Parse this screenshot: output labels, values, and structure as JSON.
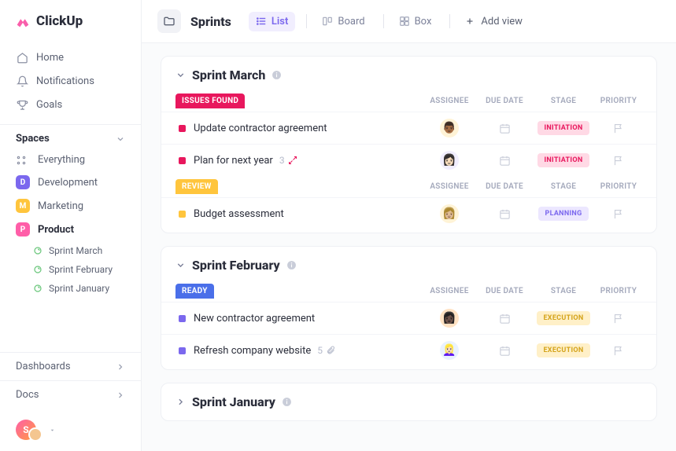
{
  "brand": "ClickUp",
  "nav": {
    "home": "Home",
    "notifications": "Notifications",
    "goals": "Goals"
  },
  "spaces_label": "Spaces",
  "everything": "Everything",
  "spaces": [
    {
      "initial": "D",
      "label": "Development",
      "color": "#7b68ee"
    },
    {
      "initial": "M",
      "label": "Marketing",
      "color": "#ffc53d"
    },
    {
      "initial": "P",
      "label": "Product",
      "color": "#ff5ea8",
      "active": true
    }
  ],
  "product_sprints": [
    "Sprint  March",
    "Sprint  February",
    "Sprint January"
  ],
  "bottom": {
    "dashboards": "Dashboards",
    "docs": "Docs"
  },
  "user_initial": "S",
  "topbar": {
    "title": "Sprints",
    "views": {
      "list": "List",
      "board": "Board",
      "box": "Box",
      "add": "Add view"
    }
  },
  "columns": {
    "assignee": "ASSIGNEE",
    "due": "DUE DATE",
    "stage": "STAGE",
    "priority": "PRIORITY"
  },
  "sprints": [
    {
      "title": "Sprint March",
      "expanded": true,
      "groups": [
        {
          "status": "ISSUES FOUND",
          "status_color": "#e8175d",
          "tasks": [
            {
              "name": "Update contractor agreement",
              "dot_color": "#e8175d",
              "avatar_bg": "#fff3d6",
              "avatar_emoji": "👨🏾",
              "stage": "INITIATION",
              "stage_bg": "#ffd9e5",
              "stage_color": "#e8175d"
            },
            {
              "name": "Plan for next year",
              "dot_color": "#e8175d",
              "avatar_bg": "#f1eefe",
              "avatar_emoji": "👩🏻",
              "stage": "INITIATION",
              "stage_bg": "#ffd9e5",
              "stage_color": "#e8175d",
              "count": "3",
              "count_icon": true
            }
          ]
        },
        {
          "status": "REVIEW",
          "status_color": "#ffc53d",
          "tasks": [
            {
              "name": "Budget assessment",
              "dot_color": "#ffc53d",
              "avatar_bg": "#fff3d6",
              "avatar_emoji": "👩🏼",
              "stage": "PLANNING",
              "stage_bg": "#ece7ff",
              "stage_color": "#7b68ee"
            }
          ]
        }
      ]
    },
    {
      "title": "Sprint February",
      "expanded": true,
      "groups": [
        {
          "status": "READY",
          "status_color": "#4a6fe9",
          "tasks": [
            {
              "name": "New contractor agreement",
              "dot_color": "#7b68ee",
              "avatar_bg": "#ffe2c3",
              "avatar_emoji": "👩🏿",
              "stage": "EXECUTION",
              "stage_bg": "#fff0c8",
              "stage_color": "#d4a31a"
            },
            {
              "name": "Refresh company website",
              "dot_color": "#7b68ee",
              "avatar_bg": "#e9f2ff",
              "avatar_emoji": "👱🏻‍♀️",
              "stage": "EXECUTION",
              "stage_bg": "#fff0c8",
              "stage_color": "#d4a31a",
              "attach_count": "5"
            }
          ]
        }
      ]
    },
    {
      "title": "Sprint January",
      "expanded": false,
      "groups": []
    }
  ]
}
